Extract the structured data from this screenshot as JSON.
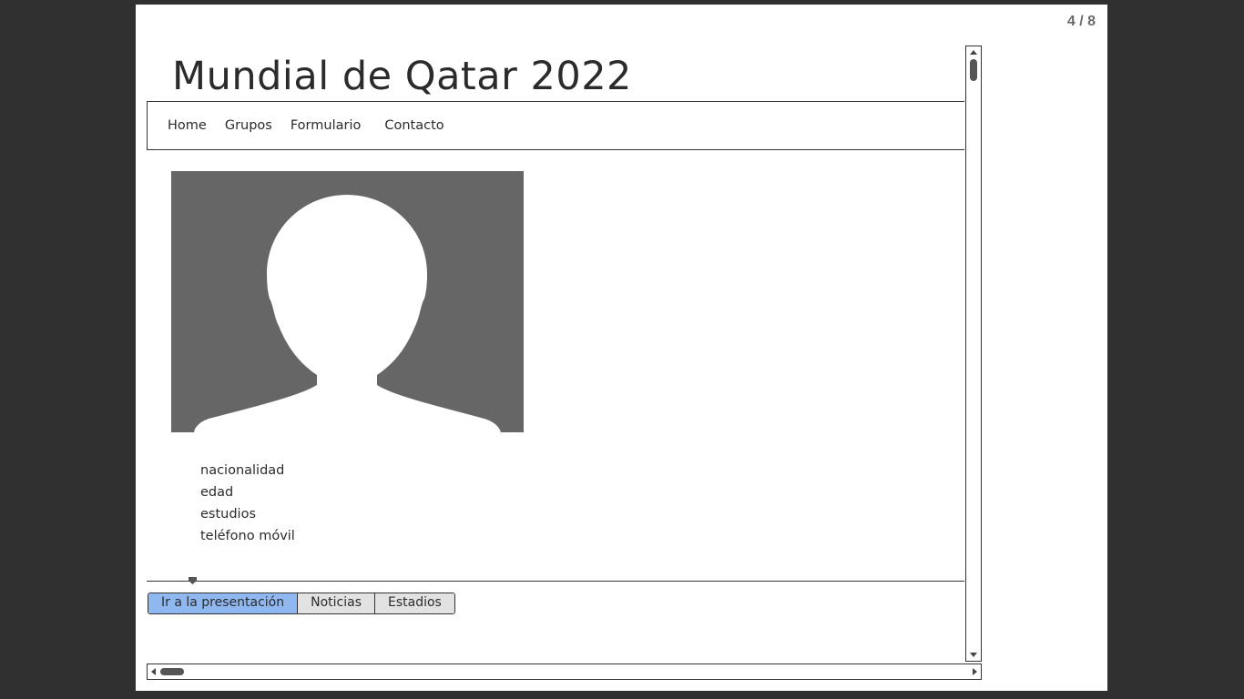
{
  "page_counter": "4 / 8",
  "site": {
    "title": "Mundial de Qatar 2022"
  },
  "nav": {
    "items": [
      {
        "label": "Home"
      },
      {
        "label": "Grupos"
      },
      {
        "label": "Formulario"
      },
      {
        "label": "Contacto"
      }
    ]
  },
  "avatar": {
    "icon": "person-silhouette-icon"
  },
  "info": {
    "items": [
      {
        "label": "nacionalidad"
      },
      {
        "label": "edad"
      },
      {
        "label": "estudios"
      },
      {
        "label": "teléfono móvil"
      }
    ]
  },
  "tabs": {
    "active": 0,
    "items": [
      {
        "label": "Ir a la presentación"
      },
      {
        "label": "Noticias"
      },
      {
        "label": "Estadios"
      }
    ]
  },
  "colors": {
    "background": "#303030",
    "active_tab": "#8fb8f0",
    "tab": "#e2e2e2",
    "avatar_bg": "#666666"
  }
}
